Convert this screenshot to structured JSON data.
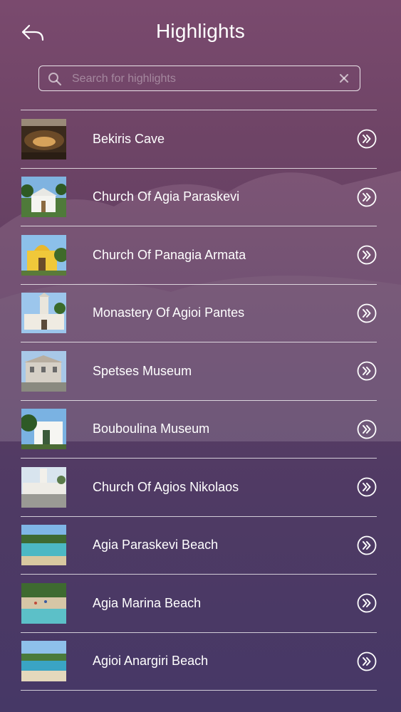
{
  "header": {
    "title": "Highlights"
  },
  "search": {
    "placeholder": "Search for highlights",
    "value": ""
  },
  "items": [
    {
      "label": "Bekiris Cave"
    },
    {
      "label": "Church Of Agia Paraskevi"
    },
    {
      "label": "Church Of Panagia Armata"
    },
    {
      "label": "Monastery Of Agioi Pantes"
    },
    {
      "label": "Spetses Museum"
    },
    {
      "label": "Bouboulina Museum"
    },
    {
      "label": "Church Of Agios Nikolaos"
    },
    {
      "label": "Agia Paraskevi Beach"
    },
    {
      "label": "Agia Marina Beach"
    },
    {
      "label": "Agioi Anargiri Beach"
    }
  ],
  "icons": {
    "back": "back-arrow-icon",
    "search": "search-icon",
    "clear": "clear-icon",
    "go": "chevron-right-circle-icon"
  }
}
